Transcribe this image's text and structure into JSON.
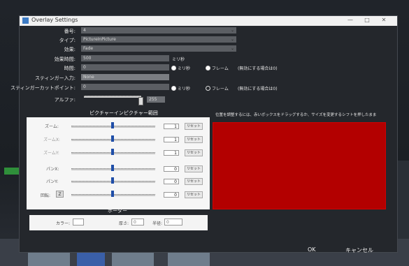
{
  "window": {
    "title": "Overlay Settings",
    "controls": {
      "minimize": "—",
      "maximize": "□",
      "close": "✕"
    }
  },
  "form": {
    "number": {
      "label": "番号:",
      "value": "4"
    },
    "type": {
      "label": "タイプ:",
      "value": "PictureInPicture"
    },
    "effect": {
      "label": "効果:",
      "value": "Fade"
    },
    "effect_time": {
      "label": "効果時間:",
      "value": "500",
      "unit": "ミリ秒"
    },
    "time": {
      "label": "時間:",
      "value": "0"
    },
    "stinger_input": {
      "label": "スティンガー入力:",
      "value": "None"
    },
    "stinger_cut": {
      "label": "スティンガーカットポイント:",
      "value": "0"
    },
    "alpha": {
      "label": "アルファ:",
      "value": "255"
    }
  },
  "time_mode": {
    "ms": "ミリ秒",
    "frame": "フレーム",
    "note": "(無効にする場合は0)"
  },
  "stinger_mode": {
    "ms": "ミリ秒",
    "frame": "フレーム",
    "note": "(無効にする場合は0)"
  },
  "pip": {
    "title": "ピクチャーインピクチャー範囲",
    "hint": "位置を調整するには、赤いボックスをドラッグするか、サイズを変更するシフトを押したまま",
    "rows": [
      {
        "label": "ズーム:",
        "value": "1",
        "reset": "リセット"
      },
      {
        "label": "ズームX:",
        "value": "1",
        "reset": "リセット"
      },
      {
        "label": "ズームY:",
        "value": "1",
        "reset": "リセット"
      },
      {
        "label": "パンX:",
        "value": "0",
        "reset": "リセット"
      },
      {
        "label": "パンY:",
        "value": "0",
        "reset": "リセット"
      },
      {
        "label": "回転:",
        "value": "0",
        "reset": "リセット"
      }
    ],
    "rotate_button": "Z"
  },
  "border": {
    "title": "ボーダー",
    "color_label": "カラー:",
    "thickness_label": "厚さ:",
    "thickness_value": "0",
    "radius_label": "半径:",
    "radius_value": "0"
  },
  "footer": {
    "ok": "OK",
    "cancel": "キャンセル"
  },
  "colors": {
    "preview_red": "#b30000",
    "accent_blue": "#1f4ea8"
  }
}
